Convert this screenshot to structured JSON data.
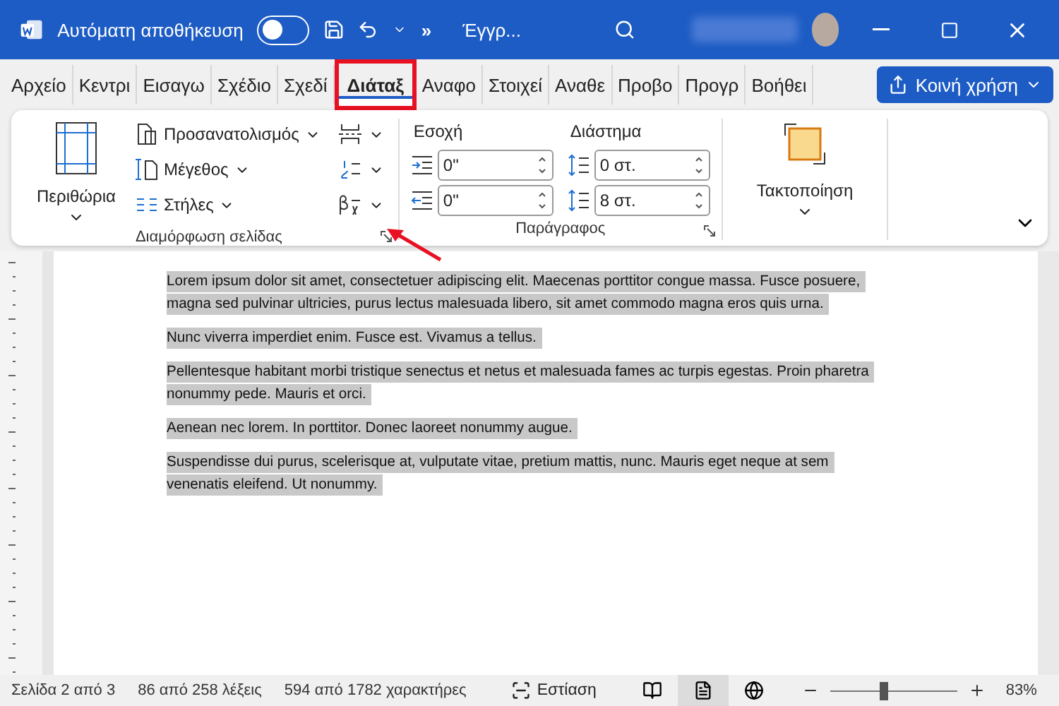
{
  "titlebar": {
    "autosave_label": "Αυτόματη αποθήκευση",
    "autosave_on": false,
    "more": "»",
    "doc_title": "Έγγρ..."
  },
  "tabs": [
    {
      "label": "Αρχείο",
      "selected": false,
      "highlighted": false
    },
    {
      "label": "Κεντρι",
      "selected": false,
      "highlighted": false
    },
    {
      "label": "Εισαγω",
      "selected": false,
      "highlighted": false
    },
    {
      "label": "Σχέδιο",
      "selected": false,
      "highlighted": false
    },
    {
      "label": "Σχεδί",
      "selected": false,
      "highlighted": false
    },
    {
      "label": "Διάταξ",
      "selected": true,
      "highlighted": true
    },
    {
      "label": "Αναφο",
      "selected": false,
      "highlighted": false
    },
    {
      "label": "Στοιχεί",
      "selected": false,
      "highlighted": false
    },
    {
      "label": "Αναθε",
      "selected": false,
      "highlighted": false
    },
    {
      "label": "Προβο",
      "selected": false,
      "highlighted": false
    },
    {
      "label": "Προγρ",
      "selected": false,
      "highlighted": false
    },
    {
      "label": "Βοήθει",
      "selected": false,
      "highlighted": false
    }
  ],
  "share_button": "Κοινή χρήση",
  "ribbon": {
    "page_setup": {
      "margins": "Περιθώρια",
      "buttons": [
        {
          "kind": "orientation",
          "label": "Προσανατολισμός"
        },
        {
          "kind": "size",
          "label": "Μέγεθος"
        },
        {
          "kind": "columns",
          "label": "Στήλες"
        }
      ],
      "label": "Διαμόρφωση σελίδας",
      "launcher_pointed": true
    },
    "paragraph": {
      "indent_label": "Εσοχή",
      "indent": [
        "0\"",
        "0\""
      ],
      "spacing_label": "Διάστημα",
      "spacing": [
        "0 στ.",
        "8 στ."
      ],
      "label": "Παράγραφος"
    },
    "arrange": {
      "label": "Τακτοποίηση"
    }
  },
  "document": {
    "selected": true,
    "paragraphs": [
      "Lorem ipsum dolor sit amet, consectetuer adipiscing elit. Maecenas porttitor congue massa. Fusce posuere, magna sed pulvinar ultricies, purus lectus malesuada libero, sit amet commodo magna eros quis urna.",
      "Nunc viverra imperdiet enim. Fusce est. Vivamus a tellus.",
      "Pellentesque habitant morbi tristique senectus et netus et malesuada fames ac turpis egestas. Proin pharetra nonummy pede. Mauris et orci.",
      "Aenean nec lorem. In porttitor. Donec laoreet nonummy augue.",
      "Suspendisse dui purus, scelerisque at, vulputate vitae, pretium mattis, nunc. Mauris eget neque at sem venenatis eleifend. Ut nonummy."
    ]
  },
  "status_bar": {
    "page": "Σελίδα 2 από 3",
    "words": "86 από 258 λέξεις",
    "chars": "594 από 1782 χαρακτήρες",
    "focus": "Εστίαση",
    "views": [
      {
        "kind": "read",
        "selected": false
      },
      {
        "kind": "print",
        "selected": true
      },
      {
        "kind": "web",
        "selected": false
      }
    ],
    "zoom": {
      "level": 0.42,
      "reading": "83%"
    }
  }
}
